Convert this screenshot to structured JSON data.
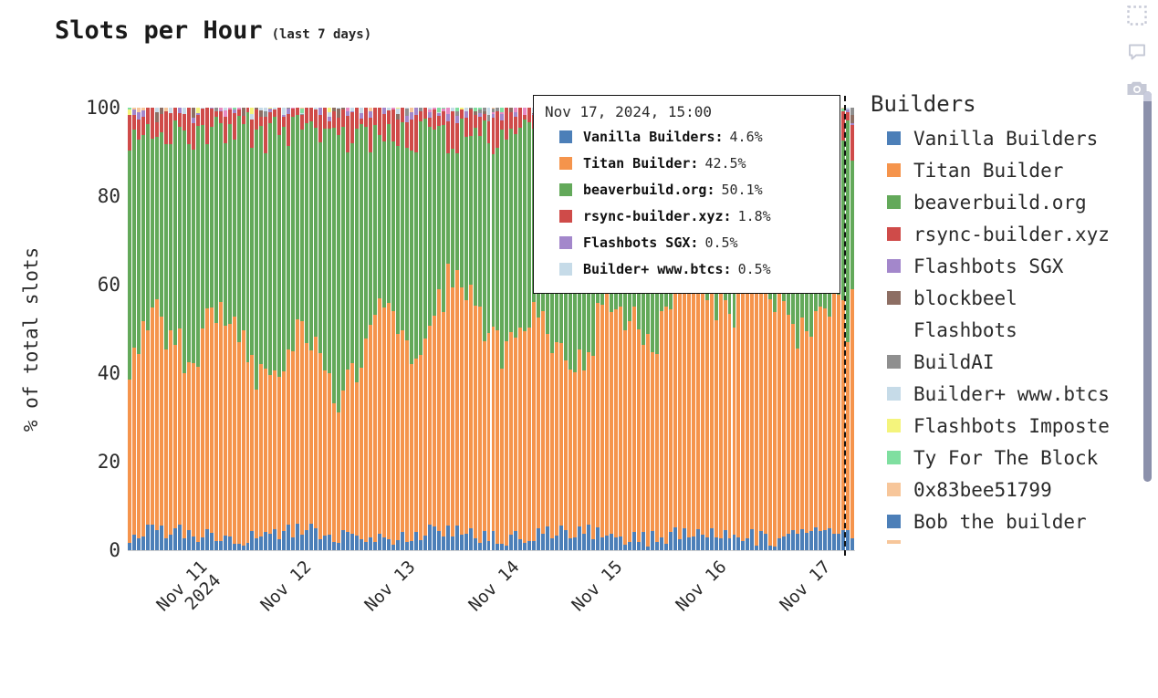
{
  "header": {
    "title": "Slots per Hour",
    "subtitle": "(last 7 days)"
  },
  "tools": [
    {
      "name": "selection-box-icon",
      "label": "Select region"
    },
    {
      "name": "comment-bubble-icon",
      "label": "Comment"
    },
    {
      "name": "camera-icon",
      "label": "Screenshot"
    }
  ],
  "axes": {
    "y_label": "% of total slots",
    "y_ticks": [
      "0",
      "20",
      "40",
      "60",
      "80",
      "100"
    ],
    "y_tick_values": [
      0,
      20,
      40,
      60,
      80,
      100
    ],
    "x_ticks": [
      {
        "line1": "Nov 11",
        "line2": "2024"
      },
      {
        "line1": "Nov 12",
        "line2": ""
      },
      {
        "line1": "Nov 13",
        "line2": ""
      },
      {
        "line1": "Nov 14",
        "line2": ""
      },
      {
        "line1": "Nov 15",
        "line2": ""
      },
      {
        "line1": "Nov 16",
        "line2": ""
      },
      {
        "line1": "Nov 17",
        "line2": ""
      }
    ]
  },
  "tooltip": {
    "date": "Nov 17, 2024, 15:00",
    "rows": [
      {
        "name": "Vanilla Builders",
        "value": "4.6%",
        "color": "#4c7fb8"
      },
      {
        "name": "Titan Builder",
        "value": "42.5%",
        "color": "#f5944c"
      },
      {
        "name": "beaverbuild.org",
        "value": "50.1%",
        "color": "#63a95a"
      },
      {
        "name": "rsync-builder.xyz",
        "value": "1.8%",
        "color": "#cf4b49"
      },
      {
        "name": "Flashbots SGX",
        "value": "0.5%",
        "color": "#a387cb"
      },
      {
        "name": "Builder+ www.btcs",
        "value": "0.5%",
        "color": "#c6dbe8"
      }
    ]
  },
  "legend": {
    "title": "Builders",
    "items": [
      {
        "label": "Vanilla Builders",
        "color": "#4c7fb8"
      },
      {
        "label": "Titan Builder",
        "color": "#f5944c"
      },
      {
        "label": "beaverbuild.org",
        "color": "#63a95a"
      },
      {
        "label": "rsync-builder.xyz",
        "color": "#cf4b49"
      },
      {
        "label": "Flashbots SGX",
        "color": "#a387cb"
      },
      {
        "label": "blockbeel",
        "color": "#8d6e63"
      },
      {
        "label": "Flashbots",
        "color": "#e徒"
      },
      {
        "label": "BuildAI",
        "color": "#8f8f8f"
      },
      {
        "label": "Builder+ www.btcs",
        "color": "#c6dbe8"
      },
      {
        "label": "Flashbots Imposte",
        "color": "#f4f47c"
      },
      {
        "label": "Ty For The Block",
        "color": "#7fdfa0"
      },
      {
        "label": "0x83bee51799",
        "color": "#f7c69a"
      },
      {
        "label": "Bob the builder",
        "color": "#4c7fb8"
      },
      {
        "label": "",
        "color": "#f7c69a"
      }
    ],
    "scrollbar_visible": true
  },
  "chart_data": {
    "type": "bar",
    "stacked": true,
    "normalized": true,
    "title": "Slots per Hour",
    "subtitle": "(last 7 days)",
    "xlabel": "",
    "ylabel": "% of total slots",
    "ylim": [
      0,
      100
    ],
    "grid": false,
    "legend_position": "right",
    "x_range": [
      "Nov 11 2024 00:00",
      "Nov 17 2024 23:00"
    ],
    "x_unit": "hour",
    "n_bars": 160,
    "hovered_bar_index": 158,
    "hovered_bar_label": "Nov 17, 2024, 15:00",
    "series": [
      {
        "name": "Vanilla Builders",
        "color": "#4c7fb8",
        "mean_pct": 3.4,
        "hovered_pct": 4.6
      },
      {
        "name": "Titan Builder",
        "color": "#f5944c",
        "mean_pct": 47.5,
        "hovered_pct": 42.5
      },
      {
        "name": "beaverbuild.org",
        "color": "#63a95a",
        "mean_pct": 41.0,
        "hovered_pct": 50.1
      },
      {
        "name": "rsync-builder.xyz",
        "color": "#cf4b49",
        "mean_pct": 5.0,
        "hovered_pct": 1.8
      },
      {
        "name": "Flashbots SGX",
        "color": "#a387cb",
        "mean_pct": 0.6,
        "hovered_pct": 0.5
      },
      {
        "name": "blockbeel",
        "color": "#8d6e63",
        "mean_pct": 0.5,
        "hovered_pct": 0.0
      },
      {
        "name": "Flashbots",
        "color": "#e78ac3",
        "mean_pct": 0.4,
        "hovered_pct": 0.0
      },
      {
        "name": "BuildAI",
        "color": "#8f8f8f",
        "mean_pct": 0.4,
        "hovered_pct": 0.0
      },
      {
        "name": "Builder+ www.btcs",
        "color": "#c6dbe8",
        "mean_pct": 0.5,
        "hovered_pct": 0.5
      },
      {
        "name": "Flashbots Imposte",
        "color": "#f4f47c",
        "mean_pct": 0.3,
        "hovered_pct": 0.0
      },
      {
        "name": "Ty For The Block",
        "color": "#7fdfa0",
        "mean_pct": 0.2,
        "hovered_pct": 0.0
      },
      {
        "name": "0x83bee51799",
        "color": "#f7c69a",
        "mean_pct": 0.2,
        "hovered_pct": 0.0
      }
    ]
  }
}
